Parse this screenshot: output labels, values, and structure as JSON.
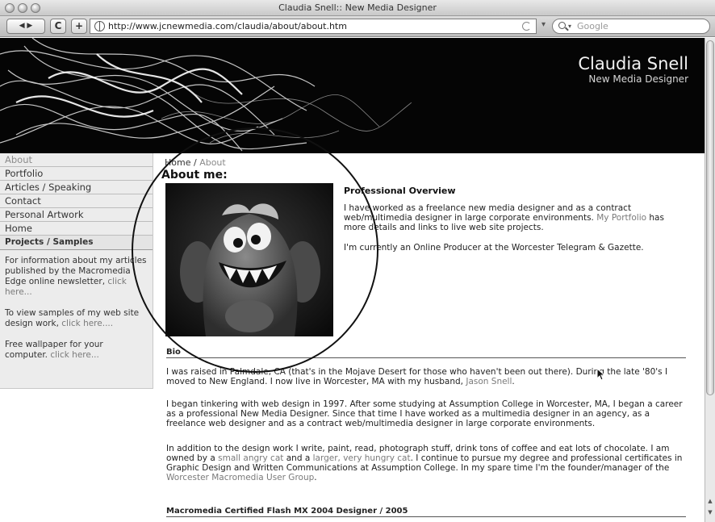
{
  "window": {
    "title": "Claudia Snell:: New Media Designer"
  },
  "toolbar": {
    "back_label": "◀ ▶",
    "reload_label": "C",
    "add_label": "+",
    "url": "http://www.jcnewmedia.com/claudia/about/about.htm",
    "search_placeholder": "Google"
  },
  "header": {
    "name": "Claudia Snell",
    "role": "New Media Designer"
  },
  "sidebar": {
    "items": [
      {
        "label": "About"
      },
      {
        "label": "Portfolio"
      },
      {
        "label": "Articles / Speaking"
      },
      {
        "label": "Contact"
      },
      {
        "label": "Personal Artwork"
      },
      {
        "label": "Home"
      }
    ],
    "section_title": "Projects / Samples",
    "blurbs": [
      {
        "text": "For information about my articles published by the Macromedia Edge online newsletter,",
        "link": "click here..."
      },
      {
        "text": "To view samples of my web site design work,",
        "link": "click here...."
      },
      {
        "text": "Free wallpaper for your computer.",
        "link": "click here..."
      }
    ]
  },
  "main": {
    "breadcrumb": {
      "home": "Home",
      "sep": " / ",
      "current": "About"
    },
    "title": "About me:",
    "overview": {
      "title": "Professional Overview",
      "p1_a": "I have worked as a freelance new media designer and as a contract web/multimedia designer in large corporate environments.",
      "p1_link": "My Portfolio",
      "p1_b": "has more details and links to live web site projects.",
      "p2": "I'm currently an Online Producer at the Worcester Telegram & Gazette."
    },
    "bio": {
      "heading": "Bio",
      "p1_a": "I was raised in Palmdale, CA (that's in the Mojave Desert for those who haven't been out there). During the late '80's I moved to New England. I now live in Worcester, MA with my husband,",
      "p1_link": "Jason Snell",
      "p1_b": ".",
      "p2": "I began tinkering with web design in 1997. After some studying at Assumption College in Worcester, MA, I began a career as a professional New Media Designer. Since that time I have worked as a multimedia designer in an agency, as a freelance web designer and as a contract web/multimedia designer in large corporate environments.",
      "p3_a": "In addition to the design work I write, paint, read, photograph stuff, drink tons of coffee and eat lots of chocolate. I am owned by a",
      "p3_link1": "small angry cat",
      "p3_b": "and a",
      "p3_link2": "larger, very hungry cat",
      "p3_c": ". I continue to pursue my degree and professional certificates in Graphic Design and Written Communications at Assumption College. In my spare time I'm the founder/manager of the",
      "p3_link3": "Worcester Macromedia User Group",
      "p3_d": "."
    },
    "cert_heading": "Macromedia Certified Flash MX 2004 Designer / 2005"
  }
}
